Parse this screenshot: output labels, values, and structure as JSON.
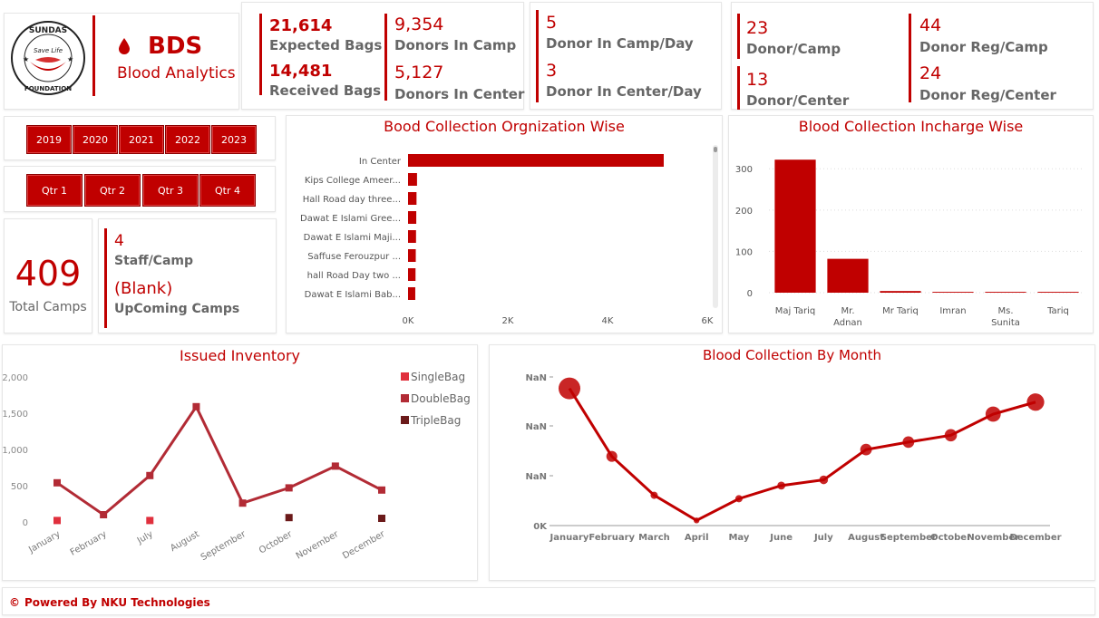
{
  "brand": {
    "logo_text_top": "SUNDAS",
    "logo_text_mid": "Save Life",
    "logo_text_bottom": "FOUNDATION",
    "icon": "blood-drop-icon",
    "title": "BDS",
    "subtitle": "Blood Analytics"
  },
  "kpi1": {
    "expected_value": "21,614",
    "expected_label": "Expected Bags",
    "received_value": "14,481",
    "received_label": "Received Bags",
    "donors_camp_value": "9,354",
    "donors_camp_label": "Donors In Camp",
    "donors_center_value": "5,127",
    "donors_center_label": "Donors In Center"
  },
  "kpi2": {
    "camp_day_value": "5",
    "camp_day_label": "Donor In Camp/Day",
    "center_day_value": "3",
    "center_day_label": "Donor In Center/Day"
  },
  "kpi3": {
    "donor_camp_value": "23",
    "donor_camp_label": "Donor/Camp",
    "donor_center_value": "13",
    "donor_center_label": "Donor/Center",
    "reg_camp_value": "44",
    "reg_camp_label": "Donor Reg/Camp",
    "reg_center_value": "24",
    "reg_center_label": "Donor Reg/Center"
  },
  "years": [
    "2019",
    "2020",
    "2021",
    "2022",
    "2023"
  ],
  "quarters": [
    "Qtr 1",
    "Qtr 2",
    "Qtr 3",
    "Qtr 4"
  ],
  "camps": {
    "total_value": "409",
    "total_label": "Total Camps"
  },
  "staff": {
    "staff_value": "4",
    "staff_label": "Staff/Camp",
    "upcoming_value": "(Blank)",
    "upcoming_label": "UpComing Camps"
  },
  "colors": {
    "accent": "#c00000",
    "single": "#e0303d",
    "double": "#b22b35",
    "triple": "#6b1a1a"
  },
  "chart_data": [
    {
      "type": "bar",
      "orientation": "horizontal",
      "title": "Bood Collection Orgnization Wise",
      "categories": [
        "In Center",
        "Kips College Ameer...",
        "Hall Road day three...",
        "Dawat E Islami Gree...",
        "Dawat E Islami Maji...",
        "Saffuse Ferouzpur ...",
        "hall Road Day two ...",
        "Dawat E Islami Bab..."
      ],
      "values": [
        5127,
        180,
        170,
        165,
        160,
        155,
        150,
        145
      ],
      "xlim": [
        0,
        6000
      ],
      "xticks": [
        "0K",
        "2K",
        "4K",
        "6K"
      ],
      "grid": false
    },
    {
      "type": "bar",
      "title": "Blood Collection Incharge Wise",
      "categories": [
        "Maj Tariq",
        "Mr. Adnan",
        "Mr Tariq",
        "Imran",
        "Ms. Sunita",
        "Tariq"
      ],
      "values": [
        322,
        82,
        4,
        2,
        2,
        2
      ],
      "ylim": [
        0,
        340
      ],
      "yticks": [
        "0",
        "100",
        "200",
        "300"
      ],
      "grid": true
    },
    {
      "type": "line",
      "title": "Issued Inventory",
      "categories": [
        "January",
        "February",
        "July",
        "August",
        "September",
        "October",
        "November",
        "December"
      ],
      "ylim": [
        0,
        2000
      ],
      "yticks": [
        "0",
        "500",
        "1,000",
        "1,500",
        "2,000"
      ],
      "legend_position": "right",
      "series": [
        {
          "name": "SingleBag",
          "values": [
            20,
            null,
            20,
            null,
            null,
            null,
            null,
            null
          ]
        },
        {
          "name": "DoubleBag",
          "values": [
            540,
            100,
            640,
            1590,
            260,
            470,
            770,
            440
          ]
        },
        {
          "name": "TripleBag",
          "values": [
            null,
            null,
            null,
            null,
            null,
            60,
            null,
            50
          ]
        }
      ]
    },
    {
      "type": "line",
      "title": "Blood Collection By Month",
      "categories": [
        "January",
        "February",
        "March",
        "April",
        "May",
        "June",
        "July",
        "August",
        "September",
        "October",
        "November",
        "December"
      ],
      "yticks": [
        "0K",
        "NaN",
        "NaN",
        "NaN"
      ],
      "values": [
        2400,
        1210,
        530,
        90,
        470,
        700,
        800,
        1330,
        1460,
        1580,
        1950,
        2160
      ],
      "point_sizes": [
        3.0,
        1.5,
        1.0,
        0.8,
        1.0,
        1.1,
        1.2,
        1.6,
        1.6,
        1.7,
        2.1,
        2.4
      ]
    }
  ],
  "footer": {
    "icon": "copyright-icon",
    "symbol": "©",
    "text": "Powered By NKU Technologies"
  }
}
